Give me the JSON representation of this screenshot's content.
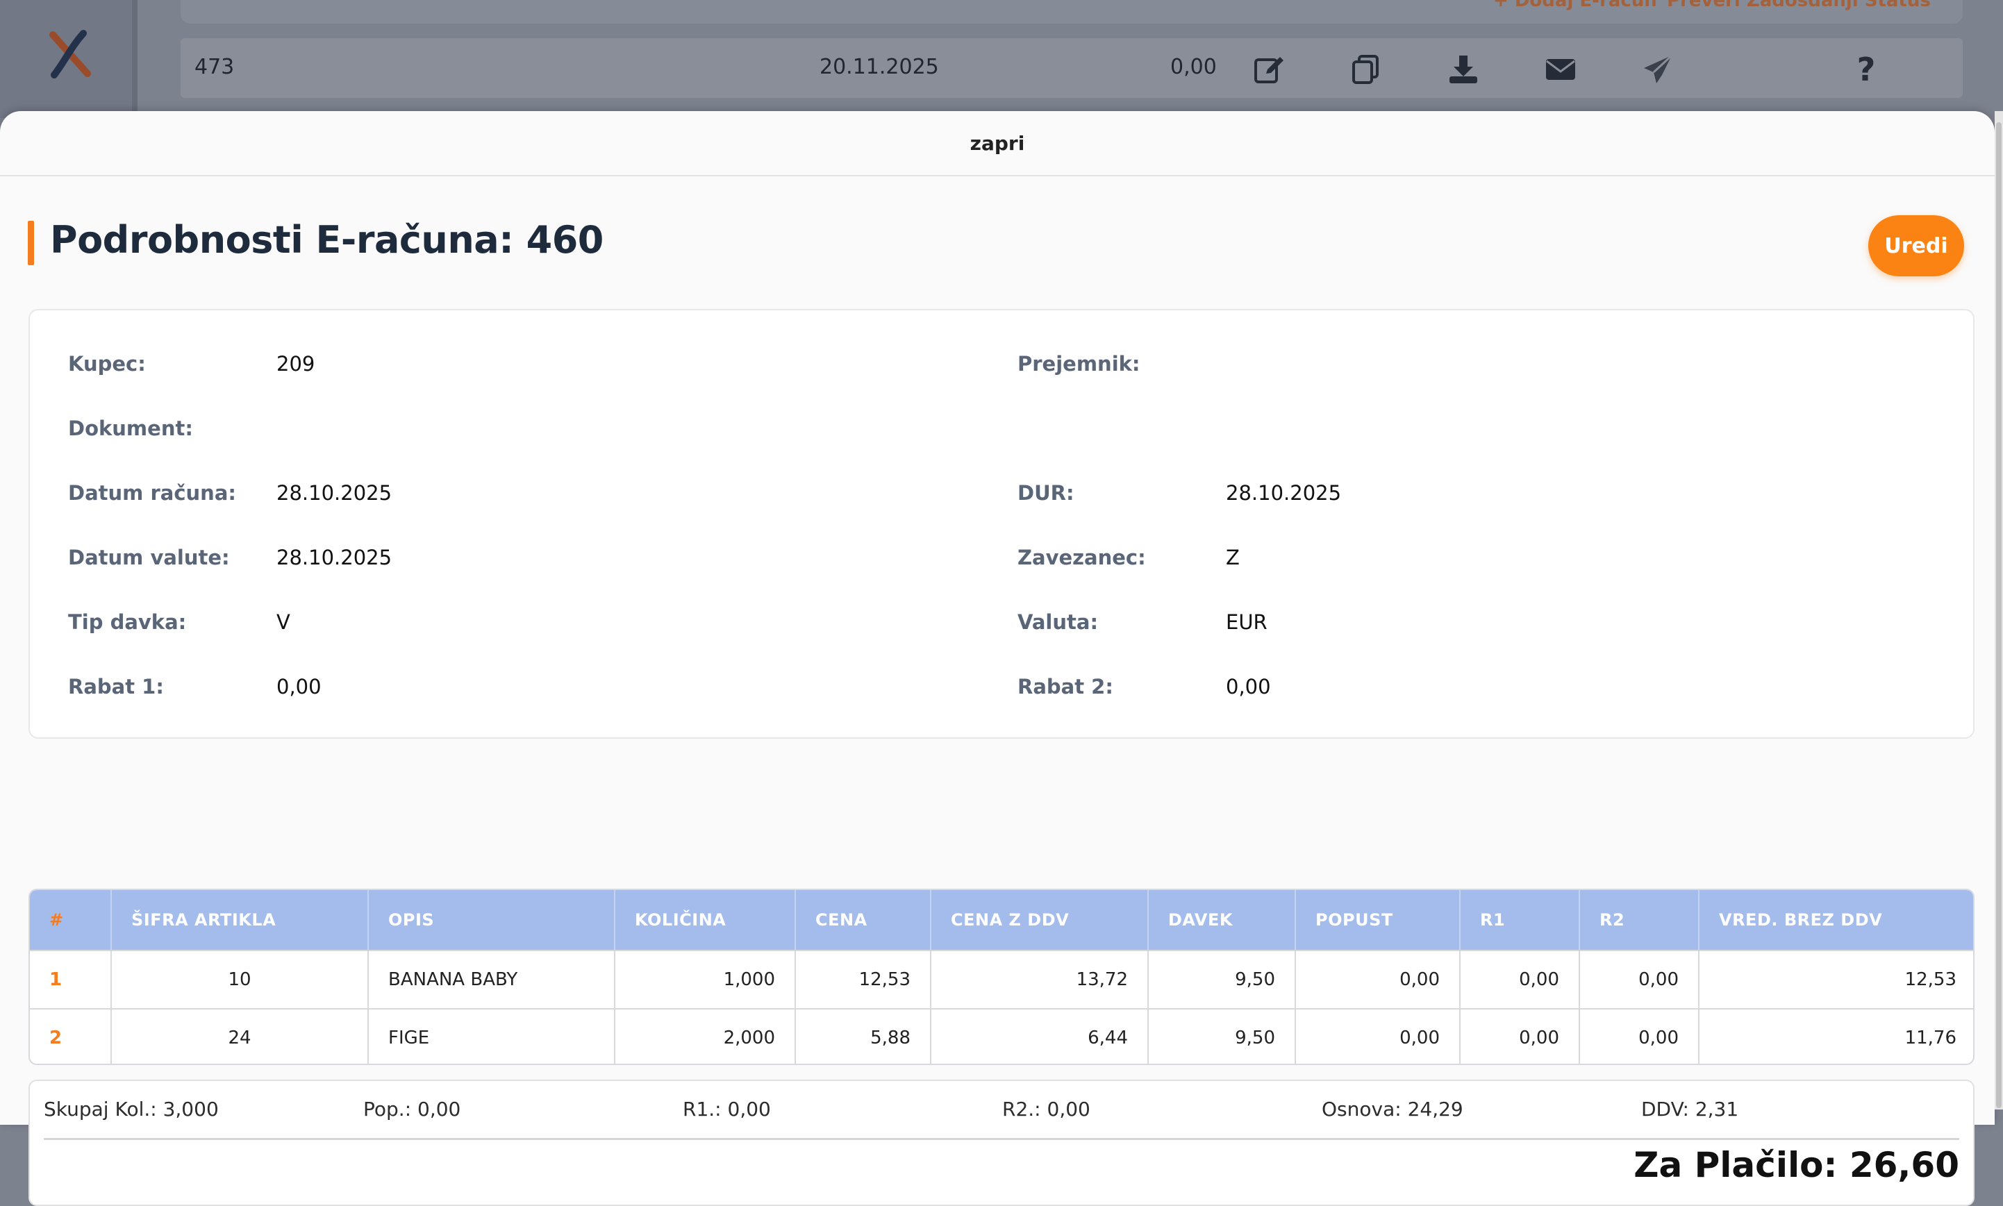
{
  "background": {
    "top_links": [
      "+ Dodaj E-račun",
      "Preveri Zadošdanji Status"
    ],
    "row": {
      "id": "473",
      "date": "20.11.2025",
      "amount": "0,00"
    },
    "row_actions": [
      "edit-icon",
      "copy-icon",
      "download-icon",
      "envelope-icon",
      "paper-plane-icon",
      "question-icon"
    ],
    "logo": "app-logo"
  },
  "modal": {
    "close_label": "zapri",
    "title": "Podrobnosti E-računa: 460",
    "edit_label": "Uredi"
  },
  "details": {
    "left": [
      {
        "label": "Kupec:",
        "value": "209"
      },
      {
        "label": "Dokument:",
        "value": ""
      },
      {
        "label": "Datum računa:",
        "value": "28.10.2025"
      },
      {
        "label": "Datum valute:",
        "value": "28.10.2025"
      },
      {
        "label": "Tip davka:",
        "value": "V"
      },
      {
        "label": "Rabat 1:",
        "value": "0,00"
      }
    ],
    "right": [
      {
        "label": "Prejemnik:",
        "value": ""
      },
      {
        "label": "DUR:",
        "value": "28.10.2025"
      },
      {
        "label": "Zavezanec:",
        "value": "Z"
      },
      {
        "label": "Valuta:",
        "value": "EUR"
      },
      {
        "label": "Rabat 2:",
        "value": "0,00"
      }
    ]
  },
  "items": {
    "columns": [
      "#",
      "ŠIFRA ARTIKLA",
      "OPIS",
      "KOLIČINA",
      "CENA",
      "CENA Z DDV",
      "DAVEK",
      "POPUST",
      "R1",
      "R2",
      "VRED. BREZ DDV"
    ],
    "rows": [
      [
        "1",
        "10",
        "BANANA BABY",
        "1,000",
        "12,53",
        "13,72",
        "9,50",
        "0,00",
        "0,00",
        "0,00",
        "12,53"
      ],
      [
        "2",
        "24",
        "FIGE",
        "2,000",
        "5,88",
        "6,44",
        "9,50",
        "0,00",
        "0,00",
        "0,00",
        "11,76"
      ]
    ]
  },
  "summary": {
    "qty": "Skupaj Kol.: 3,000",
    "discount": "Pop.: 0,00",
    "r1": "R1.: 0,00",
    "r2": "R2.: 0,00",
    "base": "Osnova: 24,29",
    "vat": "DDV: 2,31",
    "total": "Za Plačilo: 26,60"
  },
  "colors": {
    "accent": "#fb8314",
    "table_header": "#a3bcec",
    "title": "#1e2b3c"
  }
}
